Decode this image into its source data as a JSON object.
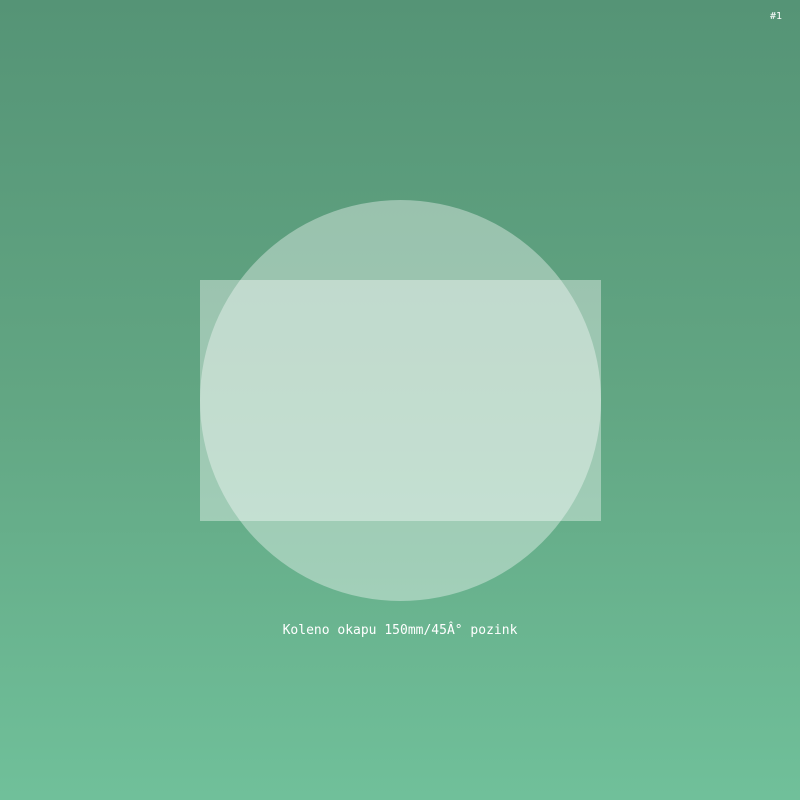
{
  "badge": "#1",
  "placeholder": {
    "icon": "image-placeholder-icon",
    "caption": "Koleno okapu 150mm/45Â° pozink"
  },
  "colors": {
    "background_top": "#559476",
    "background_bottom": "#70c09a",
    "shape_fill": "#ffffff"
  }
}
